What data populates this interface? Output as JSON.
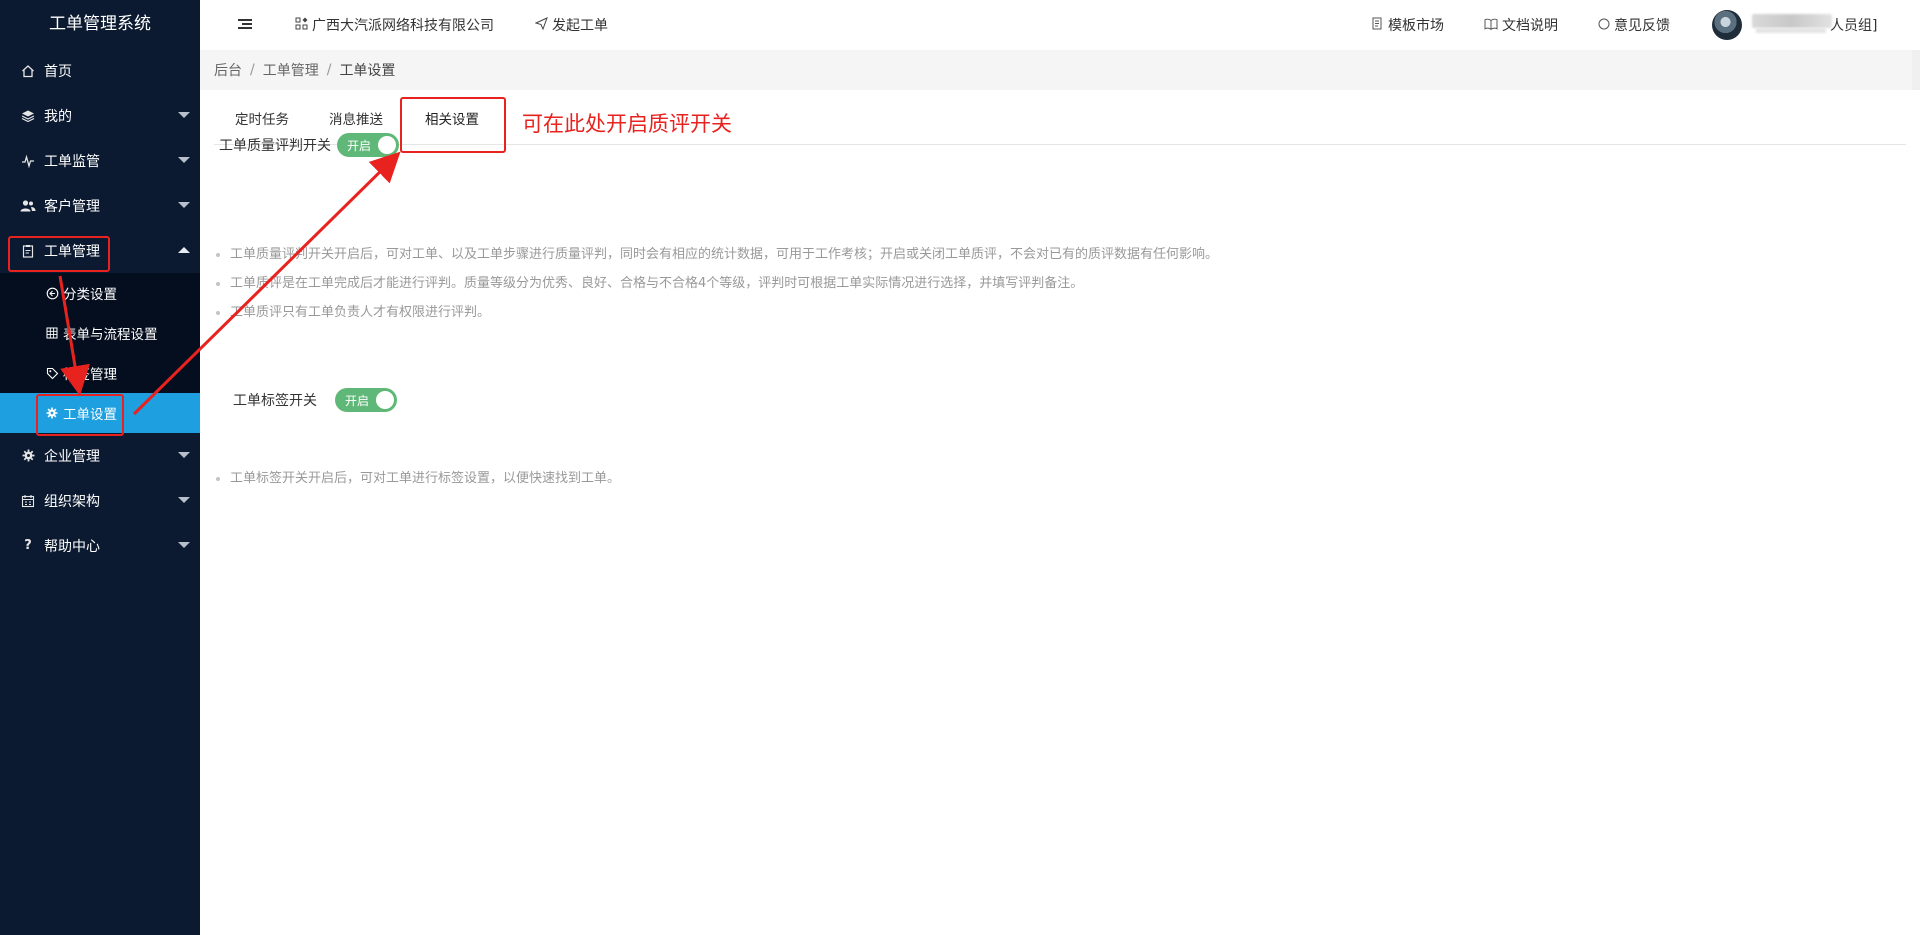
{
  "sidebar": {
    "title": "工单管理系统",
    "items": [
      {
        "label": "首页",
        "icon": "home-icon"
      },
      {
        "label": "我的",
        "icon": "layers-icon"
      },
      {
        "label": "工单监管",
        "icon": "pulse-icon"
      },
      {
        "label": "客户管理",
        "icon": "users-icon"
      },
      {
        "label": "工单管理",
        "icon": "clipboard-icon"
      },
      {
        "label": "企业管理",
        "icon": "gear-icon"
      },
      {
        "label": "组织架构",
        "icon": "calendar-icon"
      },
      {
        "label": "帮助中心",
        "icon": "question-icon"
      }
    ],
    "subitems": [
      {
        "label": "分类设置",
        "icon": "category-icon"
      },
      {
        "label": "表单与流程设置",
        "icon": "grid-icon"
      },
      {
        "label": "标签管理",
        "icon": "tag-icon"
      },
      {
        "label": "工单设置",
        "icon": "gear-icon"
      }
    ]
  },
  "header": {
    "company": "广西大汽派网络科技有限公司",
    "start_ticket": "发起工单",
    "template_market": "模板市场",
    "docs": "文档说明",
    "feedback": "意见反馈",
    "user_group": "人员组]"
  },
  "breadcrumb": [
    "后台",
    "工单管理",
    "工单设置"
  ],
  "tabs": [
    "定时任务",
    "消息推送",
    "相关设置"
  ],
  "quality_switch": {
    "label": "工单质量评判开关",
    "state": "开启"
  },
  "quality_tips": [
    "工单质量评判开关开启后，可对工单、以及工单步骤进行质量评判，同时会有相应的统计数据，可用于工作考核；开启或关闭工单质评，不会对已有的质评数据有任何影响。",
    "工单质评是在工单完成后才能进行评判。质量等级分为优秀、良好、合格与不合格4个等级，评判时可根据工单实际情况进行选择，并填写评判备注。",
    "工单质评只有工单负责人才有权限进行评判。"
  ],
  "tag_switch": {
    "label": "工单标签开关",
    "state": "开启"
  },
  "tag_tips": [
    "工单标签开关开启后，可对工单进行标签设置，以便快速找到工单。"
  ],
  "annotation": {
    "text": "可在此处开启质评开关",
    "color": "#e8231f"
  },
  "colors": {
    "sidebar_bg": "#0b1a30",
    "active_item": "#1e9fe0",
    "switch_on": "#5fb878"
  }
}
